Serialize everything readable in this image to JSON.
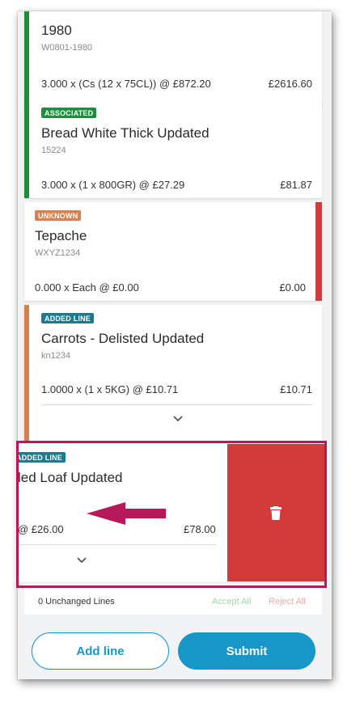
{
  "colors": {
    "green": "#1e8e3e",
    "red": "#d13c3c",
    "orange": "#d9814a",
    "teal": "#1b7b8f",
    "accent": "#1797c8",
    "delete_red": "#d23b3b",
    "highlight": "#b5195a"
  },
  "lines": [
    {
      "badge": "",
      "title": "1980",
      "code": "W0801-1980",
      "qty": "3.000 x (Cs (12 x 75CL)) @ £872.20",
      "total": "£2616.60"
    },
    {
      "badge": "ASSOCIATED",
      "title": "Bread White Thick Updated",
      "code": "15224",
      "qty": "3.000 x (1 x 800GR) @ £27.29",
      "total": "£81.87"
    },
    {
      "badge": "UNKNOWN",
      "title": "Tepache",
      "code": "WXYZ1234",
      "qty": "0.000 x Each @ £0.00",
      "total": "£0.00"
    },
    {
      "badge": "ADDED LINE",
      "title": "Carrots - Delisted Updated",
      "code": "kn1234",
      "qty": "1.0000 x (1 x 5KG) @ £10.71",
      "total": "£10.71",
      "expand_icon": "chevron-down-icon"
    },
    {
      "badge": "ADDED LINE",
      "title": "led Loaf Updated",
      "code": "",
      "qty": "@ £26.00",
      "total": "£78.00",
      "expand_icon": "chevron-down-icon",
      "delete_icon": "trash-icon"
    }
  ],
  "footer": {
    "unchanged": "0 Unchanged Lines",
    "accept_all": "Accept All",
    "reject_all": "Reject All"
  },
  "actions": {
    "add_line": "Add line",
    "submit": "Submit"
  },
  "annotation": {
    "arrow_icon": "left-arrow-icon"
  }
}
